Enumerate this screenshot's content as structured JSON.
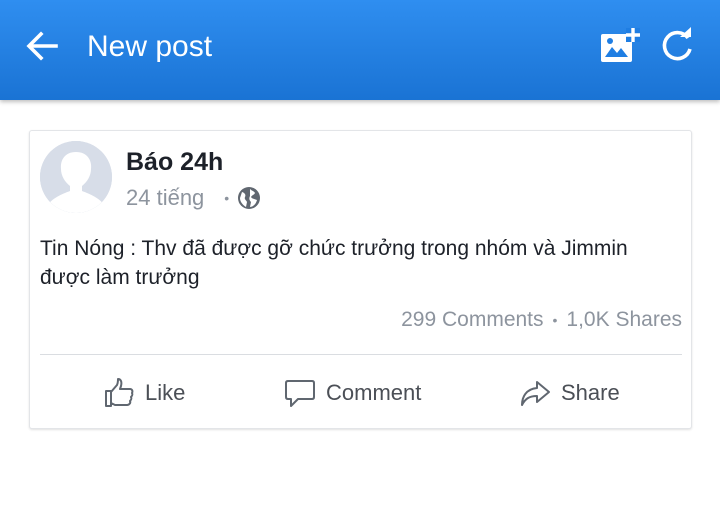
{
  "appbar": {
    "title": "New post",
    "back_icon": "arrow-left-icon",
    "add_photo_icon": "image-plus-icon",
    "refresh_icon": "refresh-icon",
    "background_color": "#1f7ee3"
  },
  "post": {
    "author": "Báo 24h",
    "time": "24 tiếng",
    "privacy_icon": "globe-icon",
    "text": "Tin Nóng : Thv đã được gỡ chức trưởng trong nhóm và Jimmin được làm trưởng",
    "comments": "299 Comments",
    "shares": "1,0K Shares"
  },
  "actions": {
    "like": "Like",
    "comment": "Comment",
    "share": "Share"
  }
}
